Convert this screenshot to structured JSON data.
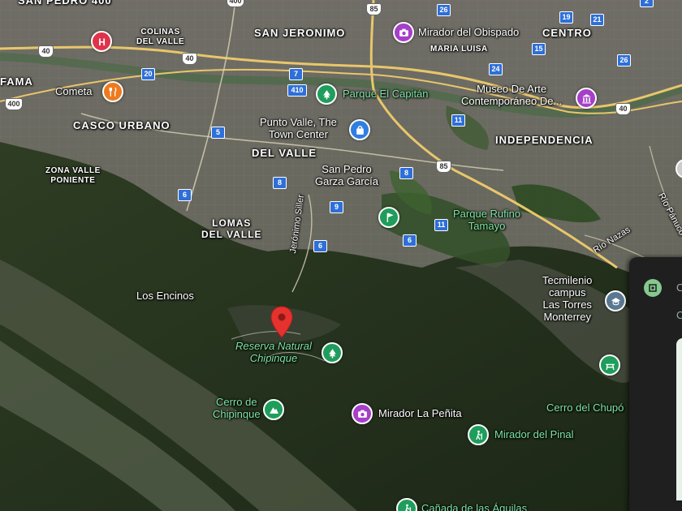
{
  "map": {
    "areas": [
      {
        "id": "san-pedro-400",
        "text": "SAN PEDRO 400"
      },
      {
        "id": "colinas",
        "text": "COLINAS\nDEL VALLE"
      },
      {
        "id": "san-jeronimo",
        "text": "SAN JERONIMO"
      },
      {
        "id": "centro",
        "text": "CENTRO"
      },
      {
        "id": "maria-luisa",
        "text": "MARIA LUISA"
      },
      {
        "id": "fama",
        "text": "FAMA"
      },
      {
        "id": "casco-urbano",
        "text": "CASCO URBANO"
      },
      {
        "id": "del-valle",
        "text": "DEL VALLE"
      },
      {
        "id": "independencia",
        "text": "INDEPENDENCIA"
      },
      {
        "id": "zona-valle",
        "text": "ZONA VALLE\nPONIENTE"
      },
      {
        "id": "lomas",
        "text": "LOMAS\nDEL VALLE"
      }
    ],
    "places": [
      {
        "id": "mirador-obispado",
        "text": "Mirador del Obispado",
        "icon": "camera-icon"
      },
      {
        "id": "cometa",
        "text": "Cometa",
        "icon": "restaurant-icon"
      },
      {
        "id": "parque-capitan",
        "text": "Parque El Capitán",
        "icon": "tree-icon"
      },
      {
        "id": "museo",
        "text": "Museo De Arte\nContemporáneo De...",
        "icon": "museum-icon"
      },
      {
        "id": "punto-valle",
        "text": "Punto Valle, The\nTown Center",
        "icon": "shopping-bag-icon"
      },
      {
        "id": "san-pedro-gg",
        "text": "San Pedro\nGarza García"
      },
      {
        "id": "parque-rufino",
        "text": "Parque Rufino\nTamayo",
        "icon": "golf-icon"
      },
      {
        "id": "tecmilenio",
        "text": "Tecmilenio\ncampus\nLas Torres\nMonterrey",
        "icon": "school-icon"
      },
      {
        "id": "los-encinos",
        "text": "Los Encinos"
      },
      {
        "id": "reserva",
        "text": "Reserva Natural\nChipinque",
        "icon": "tree-icon"
      },
      {
        "id": "cerro-chipinque",
        "text": "Cerro de\nChipinque",
        "icon": "mountain-icon"
      },
      {
        "id": "mirador-penita",
        "text": "Mirador La Peñita",
        "icon": "camera-icon"
      },
      {
        "id": "mirador-pinal",
        "text": "Mirador del Pinal",
        "icon": "hiking-icon"
      },
      {
        "id": "cerro-chupon",
        "text": "Cerro del Chupó"
      },
      {
        "id": "canada-aguilas",
        "text": "Cañada de las Águilas",
        "icon": "hiking-icon"
      }
    ],
    "streets": [
      {
        "id": "jeronimo-siller",
        "text": "Jerónimo Siller"
      },
      {
        "id": "rio-nazas",
        "text": "Río Nazas"
      },
      {
        "id": "rio-panuco",
        "text": "Río Pánuco"
      }
    ],
    "shields": [
      "400",
      "40",
      "40",
      "40",
      "85",
      "85",
      "26",
      "15",
      "19",
      "21",
      "24",
      "26",
      "20",
      "7",
      "410",
      "5",
      "6",
      "8",
      "9",
      "6",
      "8",
      "11",
      "11",
      "6",
      "400",
      "2"
    ],
    "selected_pin": {
      "icon": "location-pin-icon",
      "color": "#e5322e"
    },
    "panel": {
      "letter1": "C",
      "letter2": "C"
    }
  },
  "colors": {
    "park_pin": "#1f9d5c",
    "purple_pin": "#a63fc9",
    "orange_pin": "#ee7a1f",
    "blue_pin": "#2f7fe0",
    "road_major": "#e8c66b",
    "green_label": "#7ee6a5"
  }
}
